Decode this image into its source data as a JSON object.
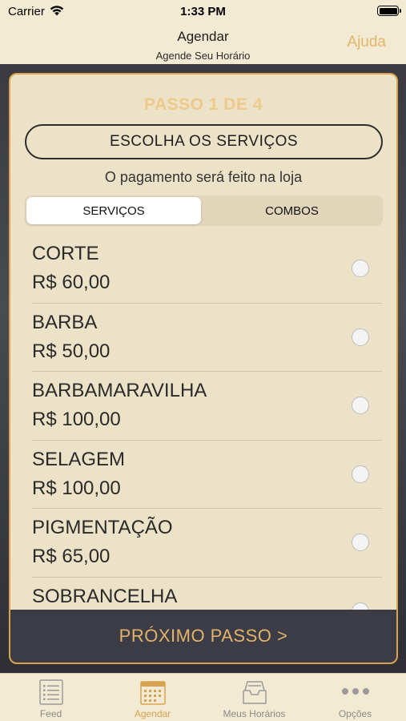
{
  "status_bar": {
    "carrier": "Carrier",
    "time": "1:33 PM",
    "wifi_icon": "wifi-icon",
    "battery_icon": "battery-icon"
  },
  "nav": {
    "title": "Agendar",
    "subtitle": "Agende Seu Horário",
    "help_label": "Ajuda"
  },
  "card": {
    "step_label": "PASSO 1 DE 4",
    "choose_label": "ESCOLHA OS SERVIÇOS",
    "payment_note": "O pagamento será feito na loja",
    "segments": [
      {
        "label": "SERVIÇOS",
        "selected": true
      },
      {
        "label": "COMBOS",
        "selected": false
      }
    ],
    "services": [
      {
        "name": "CORTE",
        "price": "R$ 60,00"
      },
      {
        "name": "BARBA",
        "price": "R$ 50,00"
      },
      {
        "name": "BARBAMARAVILHA",
        "price": "R$ 100,00"
      },
      {
        "name": "SELAGEM",
        "price": "R$ 100,00"
      },
      {
        "name": "PIGMENTAÇÃO",
        "price": "R$ 65,00"
      },
      {
        "name": "SOBRANCELHA",
        "price": ""
      }
    ],
    "next_label": "PRÓXIMO PASSO >"
  },
  "tab_bar": {
    "tabs": [
      {
        "label": "Feed",
        "icon": "feed-list-icon",
        "active": false
      },
      {
        "label": "Agendar",
        "icon": "calendar-icon",
        "active": true
      },
      {
        "label": "Meus Horários",
        "icon": "inbox-tray-icon",
        "active": false
      },
      {
        "label": "Opções",
        "icon": "more-dots-icon",
        "active": false
      }
    ]
  },
  "colors": {
    "accent": "#e2b56d",
    "background": "#f3ead3",
    "button_dark": "#3b3c45",
    "card_border": "#d9a44c"
  }
}
